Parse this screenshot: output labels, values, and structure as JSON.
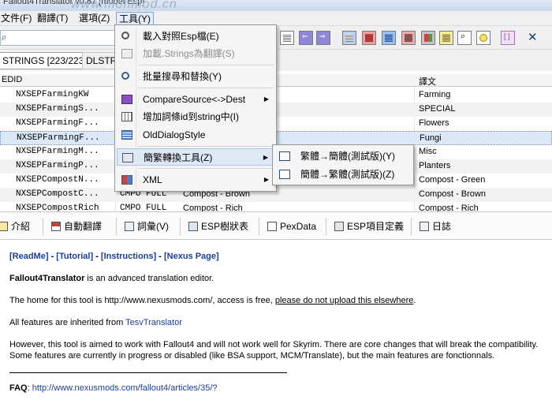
{
  "window": {
    "title": "Fallout4Translator v0.87 [model Esp]",
    "watermark": "www.mohmod.cn"
  },
  "menubar": [
    "文件(F)",
    "翻譯(T)",
    "選項(Z)",
    "工具(Y)"
  ],
  "search": {
    "value": "",
    "icon": "search-icon"
  },
  "grid_tabs": [
    "STRINGS [223/223]",
    "DLSTR"
  ],
  "grid": {
    "headers": {
      "edid": "EDID",
      "translation": "譯文"
    },
    "rows": [
      {
        "edid": "NXSEPFarmingKW",
        "sig": "",
        "full": "",
        "tr": "Farming"
      },
      {
        "edid": "NXSEPFarmingS...",
        "sig": "",
        "full": "",
        "tr": "SPECIAL"
      },
      {
        "edid": "NXSEPFarmingF...",
        "sig": "",
        "full": "",
        "tr": "Flowers"
      },
      {
        "edid": "NXSEPFarmingF...",
        "sig": "",
        "full": "",
        "tr": "Fungi"
      },
      {
        "edid": "NXSEPFarmingM...",
        "sig": "",
        "full": "",
        "tr": "Misc"
      },
      {
        "edid": "NXSEPFarmingP...",
        "sig": "",
        "full": "",
        "tr": "Planters"
      },
      {
        "edid": "NXSEPCompostN...",
        "sig": "",
        "full": "",
        "tr": "Compost - Green"
      },
      {
        "edid": "NXSEPCompostC...",
        "sig": "CMPO FULL",
        "full": "Compost - Brown",
        "tr": "Compost - Brown"
      },
      {
        "edid": "NXSEPCompostRich",
        "sig": "CMPO FULL",
        "full": "Compost - Rich",
        "tr": "Compost - Rich"
      }
    ]
  },
  "tools_menu": {
    "items": [
      {
        "label": "載入對照Esp檔(E)",
        "icon": "load-esp-icon"
      },
      {
        "label": "加載.Strings為翻譯(S)",
        "icon": "load-strings-icon",
        "disabled": true
      },
      {
        "label": "批量搜尋和替換(Y)",
        "icon": "batch-replace-icon"
      },
      {
        "label": "CompareSource<->Dest",
        "icon": "compare-icon",
        "submenu": true
      },
      {
        "label": "增加詞條id到string中(I)",
        "icon": "add-id-icon"
      },
      {
        "label": "OldDialogStyle",
        "icon": "dialog-style-icon"
      },
      {
        "label": "簡繁轉換工具(Z)",
        "icon": "convert-icon",
        "submenu": true
      },
      {
        "label": "XML",
        "icon": "xml-icon",
        "submenu": true
      }
    ],
    "convert_submenu": [
      {
        "label": "繁體→簡體(測試版)(Y)"
      },
      {
        "label": "簡體→繁體(測試版)(Z)"
      }
    ]
  },
  "bottom_tabs": [
    "介紹",
    "自動翻譯",
    "詞彙(V)",
    "ESP樹狀表",
    "PexData",
    "ESP項目定義",
    "日誌"
  ],
  "content": {
    "links": [
      "[ReadMe]",
      "[Tutorial]",
      "[Instructions]",
      "[Nexus Page]"
    ],
    "link_sep": " - ",
    "intro_bold": "Fallout4Translator",
    "intro_rest": " is an advanced translation editor.",
    "home_text": "The home for this tool is http://www.nexusmods.com/, access is free, ",
    "home_link": "please do not upload this elsewhere",
    "home_end": ".",
    "inherit_text": "All features are inherited from ",
    "inherit_link": "TesvTranslator",
    "however_1": "However, this tool is aimed to work with Fallout4 and will not work well for Skyrim. There are core changes that will break the compatibility.",
    "however_2": "Some features are currently in progress or disabled (like BSA support, MCM/Translate), but the main features are fonctionnals.",
    "faq_label": "FAQ",
    "faq_link": "http://www.nexusmods.com/fallout4/articles/35/?"
  }
}
